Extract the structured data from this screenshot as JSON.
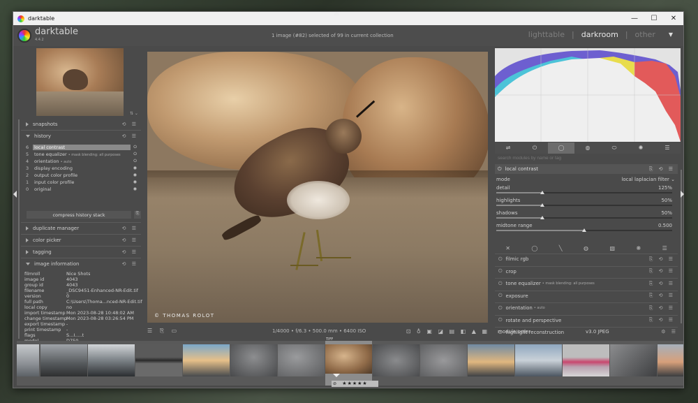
{
  "window": {
    "title": "darktable",
    "controls": [
      "—",
      "☐",
      "✕"
    ]
  },
  "header": {
    "app_name": "darktable",
    "version": "4.4.2",
    "collection_info": "1 image (#82) selected of 99 in current collection",
    "views": {
      "lighttable": "lighttable",
      "separator": "|",
      "darkroom": "darkroom",
      "other": "other",
      "caret": "▼"
    }
  },
  "left_panel": {
    "thumb_icons": "⇅ ⌄",
    "modules": {
      "snapshots": "snapshots",
      "history": "history",
      "duplicate_manager": "duplicate manager",
      "color_picker": "color picker",
      "tagging": "tagging",
      "image_information": "image information"
    },
    "module_icons": "⟲ ☰",
    "history_items": [
      {
        "n": "6",
        "label": "local contrast",
        "extra": "",
        "state": "⏻"
      },
      {
        "n": "5",
        "label": "tone equalizer",
        "extra": "• mask blending: all purposes",
        "state": "⏻"
      },
      {
        "n": "4",
        "label": "orientation",
        "extra": "• auto",
        "state": "⏻"
      },
      {
        "n": "3",
        "label": "display encoding",
        "extra": "",
        "state": "◉"
      },
      {
        "n": "2",
        "label": "output color profile",
        "extra": "",
        "state": "◉"
      },
      {
        "n": "1",
        "label": "input color profile",
        "extra": "",
        "state": "◉"
      },
      {
        "n": "0",
        "label": "original",
        "extra": "",
        "state": "◉"
      }
    ],
    "compress_label": "compress history stack",
    "compress_icon": "⎘",
    "image_info": [
      {
        "k": "filmroll",
        "v": "Nice Shots"
      },
      {
        "k": "image id",
        "v": "4043"
      },
      {
        "k": "group id",
        "v": "4043"
      },
      {
        "k": "filename",
        "v": "_DSC9451-Enhanced-NR-Edit.tif"
      },
      {
        "k": "version",
        "v": "0"
      },
      {
        "k": "full path",
        "v": "C:\\Users\\Thoma...nced-NR-Edit.tif"
      },
      {
        "k": "local copy",
        "v": "no"
      },
      {
        "k": "import timestamp",
        "v": "Mon 2023-08-28 10:48:02 AM"
      },
      {
        "k": "change timestamp",
        "v": "Mon 2023-08-28 03:26:54 PM"
      },
      {
        "k": "export timestamp",
        "v": "-"
      },
      {
        "k": "print timestamp",
        "v": "-"
      },
      {
        "k": "flags",
        "v": "S...I.....t"
      },
      {
        "k": "model",
        "v": "D750"
      }
    ]
  },
  "center": {
    "watermark": "© THOMAS ROLOT",
    "left_icons": "☰ ⎘ ▭",
    "exif": "1/4000 • f/6.3 • 500.0 mm • 6400 ISO",
    "right_icons": "⊡ ♁ ▣ ◪ ▤ ◧ ▲ ▦"
  },
  "right_panel": {
    "module_groups": [
      "⇌",
      "⏻",
      "◯",
      "◍",
      "⬭",
      "✺",
      "☰"
    ],
    "search_placeholder": "search modules by name or tag",
    "active_module": "local contrast",
    "mode_label": "mode",
    "mode_value": "local laplacian filter ⌄",
    "params": [
      {
        "label": "detail",
        "value": "125%",
        "level": 0.26
      },
      {
        "label": "highlights",
        "value": "50%",
        "level": 0.26
      },
      {
        "label": "shadows",
        "value": "50%",
        "level": 0.26
      },
      {
        "label": "midtone range",
        "value": "0.500",
        "level": 0.5
      }
    ],
    "blend_icons": [
      "✕",
      "◯",
      "╲",
      "◍",
      "▧",
      "❋",
      "☰"
    ],
    "modules": [
      {
        "label": "filmic rgb",
        "extra": ""
      },
      {
        "label": "crop",
        "extra": ""
      },
      {
        "label": "tone equalizer",
        "extra": "• mask blending: all purposes"
      },
      {
        "label": "exposure",
        "extra": ""
      },
      {
        "label": "orientation",
        "extra": "• auto"
      },
      {
        "label": "rotate and perspective",
        "extra": ""
      },
      {
        "label": "highlight reconstruction",
        "extra": ""
      }
    ],
    "module_icons": "⎘ ⟲ ☰",
    "module_order_label": "module order",
    "module_order_value": "v3.0 JPEG",
    "module_order_icons": "⚙ ☰"
  },
  "filmstrip": {
    "tiff_label": "TIFF",
    "stars": "★★★★★",
    "reject": "⊘"
  }
}
